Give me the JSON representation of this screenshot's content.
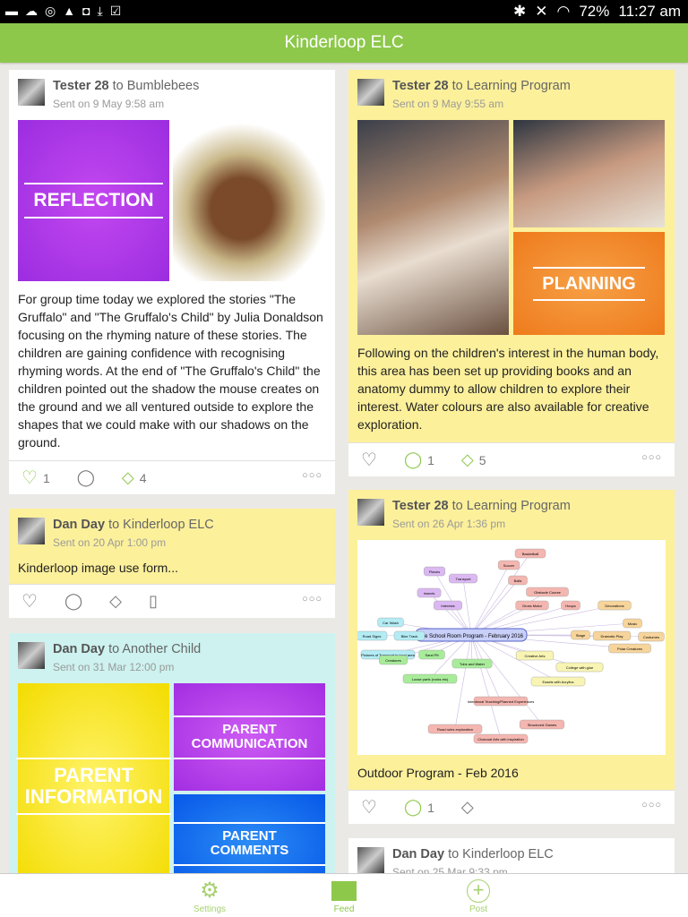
{
  "status": {
    "battery": "72%",
    "time": "11:27 am"
  },
  "app": {
    "title": "Kinderloop ELC"
  },
  "posts": [
    {
      "author": "Tester 28",
      "to": "to Bumblebees",
      "sent": "Sent on 9 May 9:58 am",
      "tile": "REFLECTION",
      "text": "For group time today we explored the stories \"The Gruffalo\" and \"The Gruffalo's Child\" by Julia Donaldson focusing on the rhyming nature of these stories. The children are gaining confidence with recognising rhyming words. At the end of \"The Gruffalo's Child\" the children pointed out the shadow the mouse creates on the ground and we all ventured outside to explore the shapes that we could make with our shadows on the ground.",
      "likes": "1",
      "tags": "4"
    },
    {
      "author": "Dan Day",
      "to": "to Kinderloop ELC",
      "sent": "Sent on 20 Apr 1:00 pm",
      "text": "Kinderloop image use form..."
    },
    {
      "author": "Dan Day",
      "to": "to Another Child",
      "sent": "Sent on 31 Mar 12:00 pm",
      "tiles": [
        "PARENT INFORMATION",
        "PARENT COMMUNICATION",
        "PARENT COMMENTS"
      ]
    },
    {
      "author": "Tester 28",
      "to": "to Learning Program",
      "sent": "Sent on 9 May 9:55 am",
      "tile": "PLANNING",
      "text": "Following on the children's interest in the human body, this area has been set up providing books and an anatomy dummy to allow children to explore their interest. Water colours are also available for creative exploration.",
      "comments": "1",
      "tags": "5"
    },
    {
      "author": "Tester 28",
      "to": "to Learning Program",
      "sent": "Sent on 26 Apr 1:36 pm",
      "text": "Outdoor Program - Feb 2016",
      "comments": "1",
      "mindmap": {
        "center": "Pre School Room Program - February 2016",
        "nodes": [
          "Basketball",
          "Soccer",
          "Balls",
          "Obstacle Course",
          "Gross Motor",
          "Hoops",
          "Planes",
          "Transport",
          "Insects",
          "Interests",
          "Decorations",
          "Music",
          "Stage",
          "Dramatic Play",
          "Costumes",
          "Polar Creatures",
          "Car Wash",
          "Road Signs",
          "Bike Track",
          "Pictures of Transport in local area",
          "Creatures",
          "Sand Pit",
          "Tubs and Water",
          "Creative Arts",
          "College with glue",
          "Loose parts (rocks etc)",
          "Easels with Acrylics",
          "Intentional Teaching/Planned Experiences",
          "Structured Games",
          "Road rules exploration",
          "Charcoal Arts with inspiration"
        ]
      }
    },
    {
      "author": "Dan Day",
      "to": "to Kinderloop ELC",
      "sent": "Sent on 25 Mar 9:33 pm"
    }
  ],
  "nav": {
    "settings": "Settings",
    "feed": "Feed",
    "post": "Post"
  }
}
